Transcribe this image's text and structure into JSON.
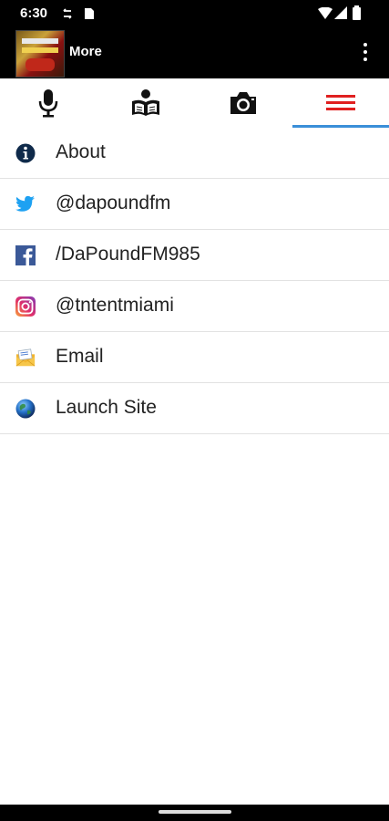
{
  "status_bar": {
    "time": "6:30",
    "icons": [
      "sync-icon",
      "sim-card-icon",
      "wifi-icon",
      "signal-icon",
      "battery-icon"
    ]
  },
  "app_bar": {
    "title": "More",
    "logo_icon": "station-logo",
    "overflow_icon": "more-vert-icon"
  },
  "tabs": [
    {
      "icon": "microphone-icon",
      "selected": false
    },
    {
      "icon": "reader-icon",
      "selected": false
    },
    {
      "icon": "camera-icon",
      "selected": false
    },
    {
      "icon": "hamburger-menu-icon",
      "selected": true
    }
  ],
  "colors": {
    "accent_underline": "#3a8fd8",
    "selected_tab_icon": "#e02020",
    "twitter": "#1da1f2",
    "facebook": "#3b5998"
  },
  "menu": [
    {
      "label": "About",
      "icon": "info-icon"
    },
    {
      "label": "@dapoundfm",
      "icon": "twitter-icon"
    },
    {
      "label": "/DaPoundFM985",
      "icon": "facebook-icon"
    },
    {
      "label": "@tntentmiami",
      "icon": "instagram-icon"
    },
    {
      "label": "Email",
      "icon": "email-icon"
    },
    {
      "label": "Launch Site",
      "icon": "globe-icon"
    }
  ]
}
